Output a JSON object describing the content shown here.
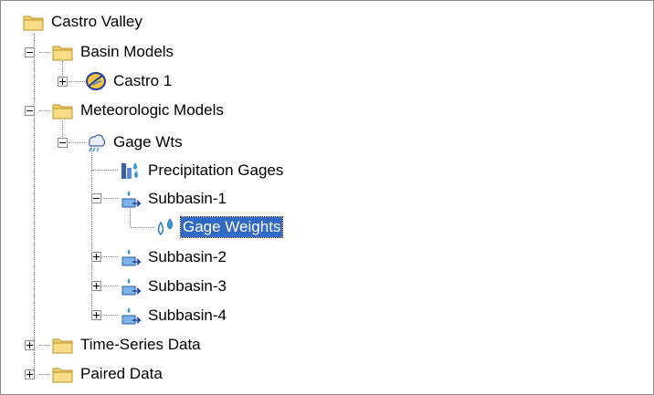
{
  "tree": {
    "root": {
      "label": "Castro Valley",
      "icon": "folder-icon"
    },
    "basin_models": {
      "label": "Basin Models",
      "icon": "folder-icon",
      "expanded": true
    },
    "castro1": {
      "label": "Castro 1",
      "icon": "basin-model-icon",
      "expanded": false
    },
    "met_models": {
      "label": "Meteorologic Models",
      "icon": "folder-icon",
      "expanded": true
    },
    "gage_wts": {
      "label": "Gage Wts",
      "icon": "meteorologic-model-icon",
      "expanded": true
    },
    "precip_gages": {
      "label": "Precipitation Gages",
      "icon": "precipitation-gages-icon"
    },
    "subbasin1": {
      "label": "Subbasin-1",
      "icon": "subbasin-icon",
      "expanded": true
    },
    "gage_weights": {
      "label": "Gage Weights",
      "icon": "gage-weights-icon",
      "selected": true
    },
    "subbasin2": {
      "label": "Subbasin-2",
      "icon": "subbasin-icon",
      "expanded": false
    },
    "subbasin3": {
      "label": "Subbasin-3",
      "icon": "subbasin-icon",
      "expanded": false
    },
    "subbasin4": {
      "label": "Subbasin-4",
      "icon": "subbasin-icon",
      "expanded": false
    },
    "time_series": {
      "label": "Time-Series Data",
      "icon": "folder-icon",
      "expanded": false
    },
    "paired_data": {
      "label": "Paired Data",
      "icon": "folder-icon",
      "expanded": false
    }
  },
  "colors": {
    "folder": "#f2cf6a",
    "selection": "#3169c6",
    "water": "#3a9ad9"
  }
}
